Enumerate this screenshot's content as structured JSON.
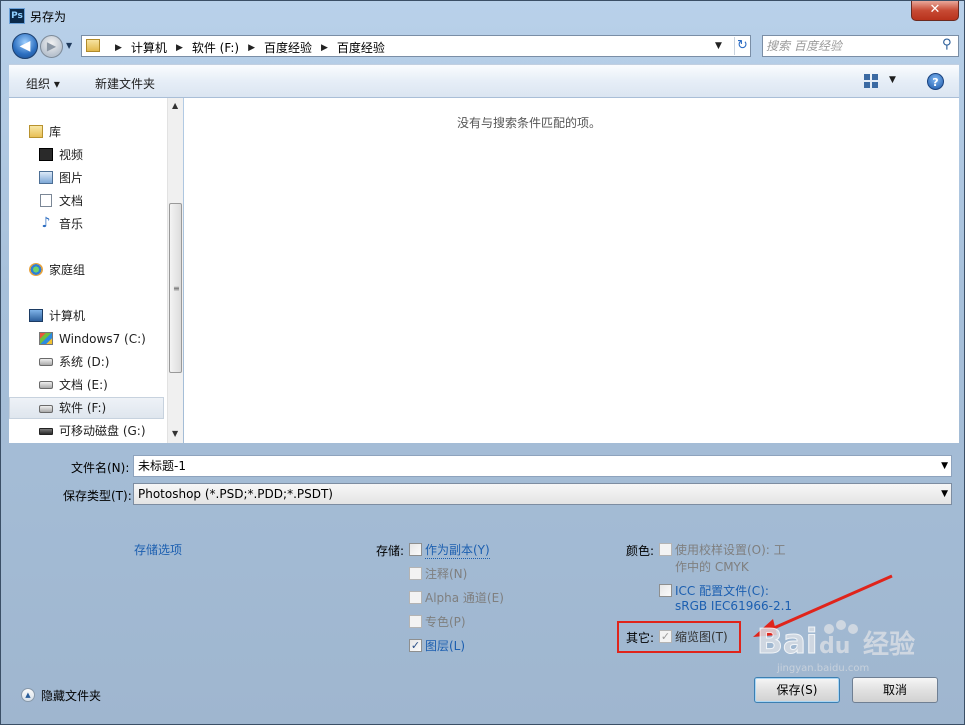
{
  "window": {
    "app_icon_text": "Ps",
    "title": "另存为",
    "close": "✕"
  },
  "nav": {
    "back": "◀",
    "forward": "▶",
    "history": "▼",
    "breadcrumbs": [
      "计算机",
      "软件 (F:)",
      "百度经验",
      "百度经验"
    ],
    "refresh": "↻",
    "dropdown": "▼",
    "search_placeholder": "搜索 百度经验",
    "search_icon": "⚲"
  },
  "toolbar": {
    "organize": "组织 ▾",
    "new_folder": "新建文件夹",
    "view_dropdown": "▼",
    "help": "?"
  },
  "sidebar": {
    "items": [
      {
        "label": "库",
        "icon": "library-icon"
      },
      {
        "label": "视频",
        "icon": "video-icon"
      },
      {
        "label": "图片",
        "icon": "pictures-icon"
      },
      {
        "label": "文档",
        "icon": "documents-icon"
      },
      {
        "label": "音乐",
        "icon": "music-icon",
        "glyph": "♪"
      },
      {
        "label": "家庭组",
        "icon": "homegroup-icon"
      },
      {
        "label": "计算机",
        "icon": "computer-icon"
      },
      {
        "label": "Windows7 (C:)",
        "icon": "windows-drive-icon"
      },
      {
        "label": "系统 (D:)",
        "icon": "drive-icon"
      },
      {
        "label": "文档 (E:)",
        "icon": "drive-icon"
      },
      {
        "label": "软件 (F:)",
        "icon": "drive-icon",
        "selected": true
      },
      {
        "label": "可移动磁盘 (G:)",
        "icon": "usb-drive-icon"
      }
    ],
    "scroll_up": "▲",
    "scroll_down": "▼",
    "grip": "≡"
  },
  "content": {
    "empty_message": "没有与搜索条件匹配的项。"
  },
  "form": {
    "filename_label": "文件名(N):",
    "filename_value": "未标题-1",
    "filetype_label": "保存类型(T):",
    "filetype_value": "Photoshop (*.PSD;*.PDD;*.PSDT)",
    "dropdown": "▼"
  },
  "options": {
    "storage_options_link": "存储选项",
    "save_label": "存储:",
    "save_items": [
      {
        "label": "作为副本(Y)",
        "checked": false,
        "disabled": false
      },
      {
        "label": "注释(N)",
        "checked": false,
        "disabled": true
      },
      {
        "label": "Alpha 通道(E)",
        "checked": false,
        "disabled": true
      },
      {
        "label": "专色(P)",
        "checked": false,
        "disabled": true
      },
      {
        "label": "图层(L)",
        "checked": true,
        "disabled": false
      }
    ],
    "color_label": "颜色:",
    "proof_label_line1": "使用校样设置(O): 工",
    "proof_label_line2": "作中的 CMYK",
    "icc_line1": "ICC 配置文件(C):",
    "icc_line2": "sRGB IEC61966-2.1",
    "other_label": "其它:",
    "thumbnail_label": "缩览图(T)",
    "check_mark": "✓"
  },
  "buttons": {
    "save": "保存(S)",
    "cancel": "取消"
  },
  "footer": {
    "hide_folders": "隐藏文件夹",
    "hide_icon_glyph": "▲"
  },
  "watermark": {
    "brand": "Bai",
    "brand2": "du",
    "suffix": "经验",
    "url": "jingyan.baidu.com"
  },
  "colors": {
    "annotation_red": "#e0241b",
    "link_blue": "#1c5fb0"
  }
}
